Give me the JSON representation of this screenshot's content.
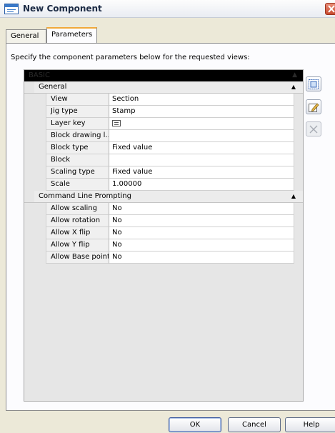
{
  "window": {
    "title": "New Component"
  },
  "tabs": [
    {
      "label": "General",
      "active": false
    },
    {
      "label": "Parameters",
      "active": true
    }
  ],
  "instruction": "Specify the component parameters below for the requested views:",
  "grid": {
    "header": {
      "label": "BASIC"
    },
    "categories": [
      {
        "label": "General",
        "expanded": true,
        "properties": [
          {
            "name": "View",
            "value": "Section"
          },
          {
            "name": "Jig type",
            "value": "Stamp"
          },
          {
            "name": "Layer key",
            "value": "",
            "icon": "layer-key-icon"
          },
          {
            "name": "Block drawing l...",
            "value": ""
          },
          {
            "name": "Block type",
            "value": "Fixed value"
          },
          {
            "name": "Block",
            "value": ""
          },
          {
            "name": "Scaling type",
            "value": "Fixed value"
          },
          {
            "name": "Scale",
            "value": "1.00000"
          }
        ]
      },
      {
        "label": "Command Line Prompting",
        "expanded": true,
        "properties": [
          {
            "name": "Allow scaling",
            "value": "No"
          },
          {
            "name": "Allow rotation",
            "value": "No"
          },
          {
            "name": "Allow X flip",
            "value": "No"
          },
          {
            "name": "Allow Y flip",
            "value": "No"
          },
          {
            "name": "Allow Base point",
            "value": "No"
          }
        ]
      }
    ]
  },
  "side_buttons": [
    {
      "icon": "select-view-icon",
      "enabled": true
    },
    {
      "icon": "edit-icon",
      "enabled": true
    },
    {
      "icon": "delete-icon",
      "enabled": false
    }
  ],
  "buttons": {
    "ok": "OK",
    "cancel": "Cancel",
    "help": "Help"
  },
  "colors": {
    "tab_highlight": "#f1a93a",
    "close_button": "#c74a2f",
    "grid_header": "#000000"
  }
}
